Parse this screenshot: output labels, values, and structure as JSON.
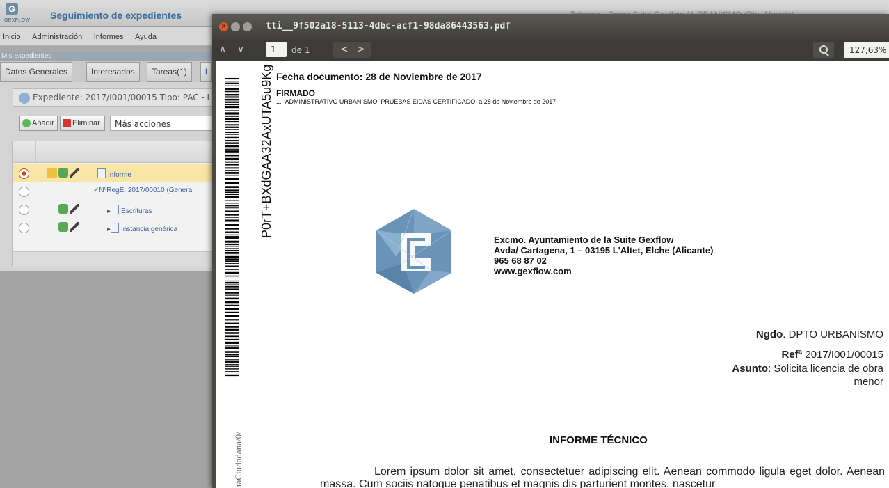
{
  "app": {
    "logo_text": "GEXFLOW",
    "logo_letter": "G",
    "title": "Seguimiento de expedientes",
    "user_info": "Taberno - Demo Suite Gexflow / URBANISMO (Dip. Almeria)",
    "menu": [
      "Inicio",
      "Administración",
      "Informes",
      "Ayuda"
    ],
    "subbar": "Mis expedientes",
    "tabs": [
      "Datos Generales",
      "Interesados",
      "Tareas(1)",
      "I"
    ],
    "expediente_line": "Expediente: 2017/I001/00015 Tipo: PAC - I",
    "buttons": {
      "add": "Añadir",
      "delete": "Eliminar"
    },
    "actions_select": "Más acciones",
    "rows": [
      {
        "text": "Informe",
        "selected": true
      },
      {
        "text": "NºRegE: 2017/00010 (Genera",
        "selected": false
      },
      {
        "text": "Escrituras",
        "selected": false
      },
      {
        "text": "Instancia genérica",
        "selected": false
      }
    ]
  },
  "viewer": {
    "close_glyph": "×",
    "title": "tti__9f502a18-5113-4dbc-acf1-98da86443563.pdf",
    "prev_glyph": "∧",
    "next_glyph": "∨",
    "page_current": "1",
    "page_of": "de 1",
    "back_glyph": "<",
    "forward_glyph": ">",
    "zoom": "127,63%"
  },
  "document": {
    "barcode_text": "P0rT+BXdGAA32AxUTA5u9Kg",
    "side_text": "taCiudadana/0/",
    "fecha": "Fecha documento: 28 de Noviembre de 2017",
    "firmado": "FIRMADO",
    "firmado_line": "1.- ADMINISTRATIVO URBANISMO, PRUEBAS EIDAS CERTIFICADO, a 28 de Noviembre de 2017",
    "org_name": "Excmo. Ayuntamiento de la Suite Gexflow",
    "org_address": "Avda/ Cartagena, 1 – 03195 L'Altet, Elche  (Alicante)",
    "org_phone": "965 68 87 02",
    "org_web": "www.gexflow.com",
    "ngdo_label": "Ngdo",
    "ngdo_value": ". DPTO URBANISMO",
    "ref_label": "Refª",
    "ref_value": " 2017/I001/00015",
    "asunto_label": "Asunto",
    "asunto_value": ": Solicita licencia de obra",
    "asunto_value_2": "menor",
    "informe_title": "INFORME TÉCNICO",
    "body": "Lorem ipsum dolor sit amet, consectetuer adipiscing elit. Aenean commodo ligula eget dolor. Aenean massa. Cum sociis natoque penatibus et magnis dis parturient montes, nascetur"
  },
  "colors": {
    "app_title": "#3c6c9c",
    "selected_row": "#f7e6a6",
    "viewer_bg": "#4a4943",
    "close_button": "#e2572c",
    "logo_blue": "#6b93b8"
  }
}
